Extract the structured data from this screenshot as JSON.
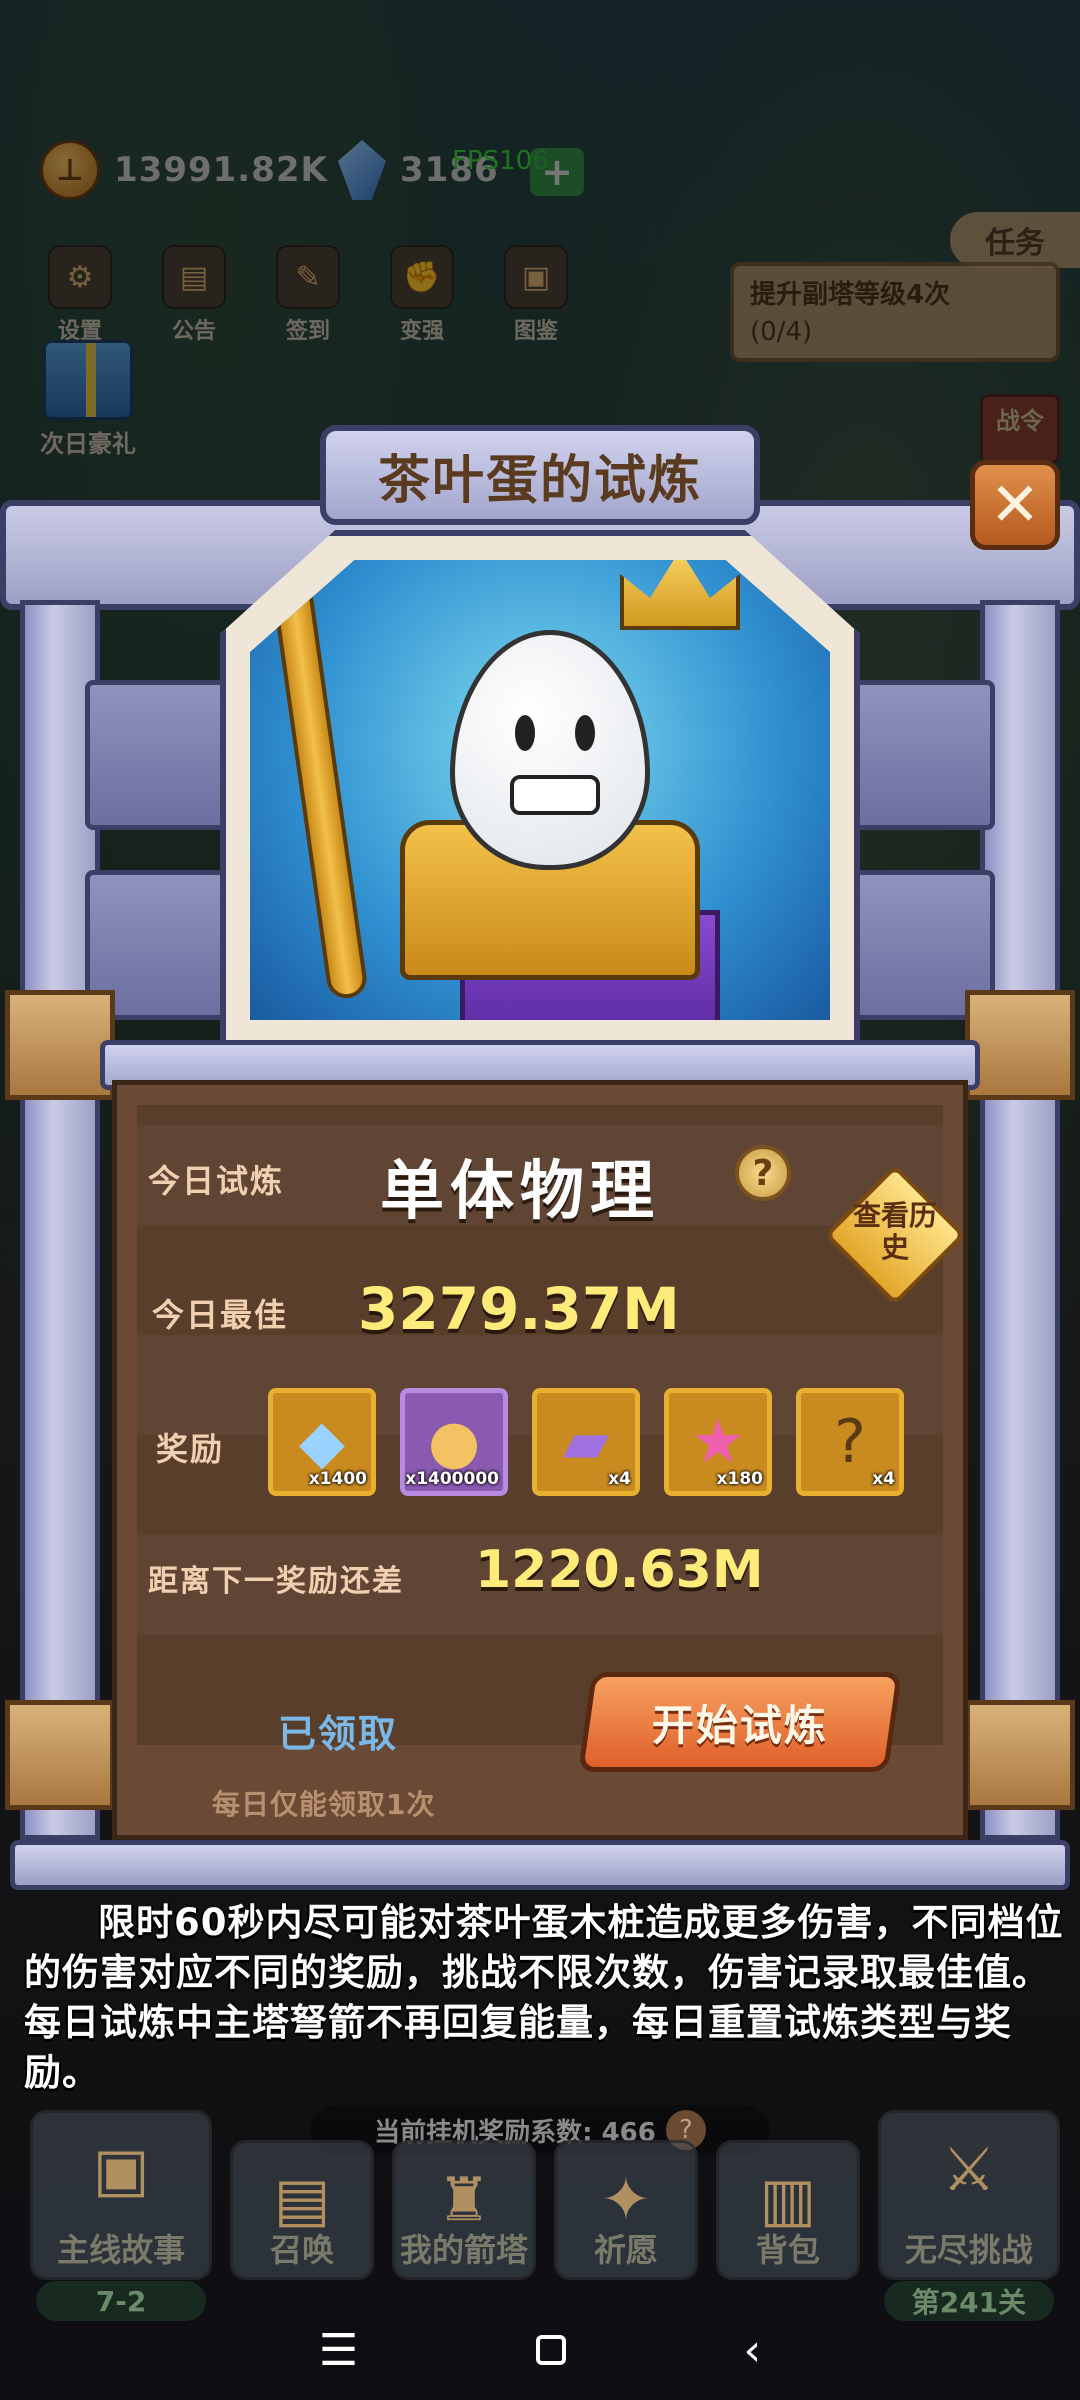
{
  "hud": {
    "gold": "13991.82K",
    "gems": "3186",
    "fps": "FPS106",
    "add_symbol": "+"
  },
  "top_menu": [
    {
      "label": "设置",
      "icon": "gear-icon"
    },
    {
      "label": "公告",
      "icon": "scroll-icon"
    },
    {
      "label": "签到",
      "icon": "feather-icon"
    },
    {
      "label": "变强",
      "icon": "fist-icon"
    },
    {
      "label": "图鉴",
      "icon": "book-icon"
    }
  ],
  "gift_label": "次日豪礼",
  "task": {
    "tab_label": "任务",
    "title": "提升副塔等级4次",
    "progress": "(0/4)"
  },
  "battle_pass_label": "战令",
  "modal": {
    "title": "茶叶蛋的试炼",
    "close_symbol": "✕",
    "today_trial_label": "今日试炼",
    "trial_type": "单体物理",
    "help_symbol": "?",
    "history_label": "查看历史",
    "today_best_label": "今日最佳",
    "today_best_value": "3279.37M",
    "rewards_label": "奖励",
    "rewards": [
      {
        "icon": "blue-crystal-icon",
        "qty": "x1400",
        "style": "gold"
      },
      {
        "icon": "gold-coin-icon",
        "qty": "x1400000",
        "style": "purple"
      },
      {
        "icon": "purple-ticket-icon",
        "qty": "x4",
        "style": "gold"
      },
      {
        "icon": "rainbow-star-icon",
        "qty": "x180",
        "style": "gold"
      },
      {
        "icon": "mystery-box-icon",
        "qty": "x4",
        "style": "gold"
      }
    ],
    "next_reward_label": "距离下一奖励还差",
    "next_reward_value": "1220.63M",
    "claimed_label": "已领取",
    "daily_note": "每日仅能领取1次",
    "start_button": "开始试炼"
  },
  "description": "限时60秒内尽可能对茶叶蛋木桩造成更多伤害，不同档位的伤害对应不同的奖励，挑战不限次数，伤害记录取最佳值。每日试炼中主塔弩箭不再回复能量，每日重置试炼类型与奖励。",
  "idle": {
    "label": "当前挂机奖励系数: 466",
    "help_symbol": "?"
  },
  "bottom_nav": [
    {
      "label": "主线故事",
      "sub": "7-2",
      "icon": "book-icon"
    },
    {
      "label": "召唤",
      "icon": "scroll-icon"
    },
    {
      "label": "我的箭塔",
      "icon": "tower-icon"
    },
    {
      "label": "祈愿",
      "icon": "star-icon"
    },
    {
      "label": "背包",
      "icon": "backpack-icon"
    },
    {
      "label": "无尽挑战",
      "sub": "第241关",
      "icon": "sword-icon"
    }
  ],
  "system_nav": {
    "menu_symbol": "☰",
    "back_symbol": "‹"
  }
}
